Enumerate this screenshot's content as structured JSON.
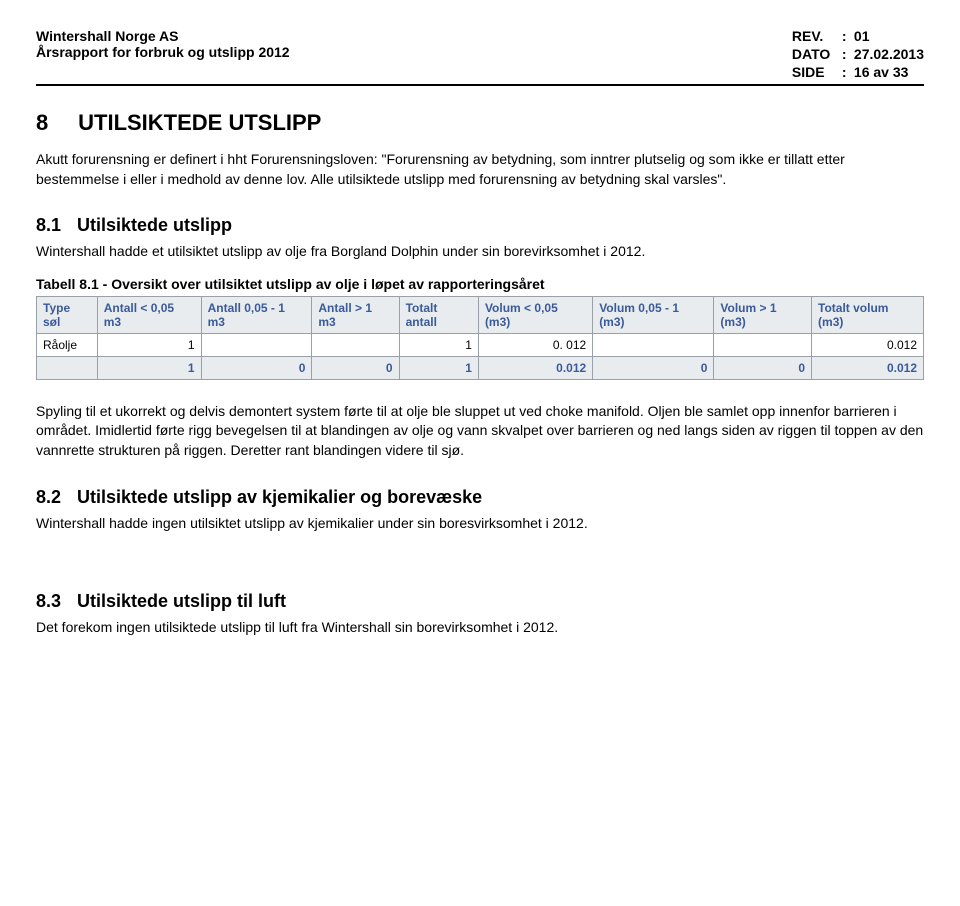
{
  "header": {
    "company": "Wintershall Norge AS",
    "subtitle": "Årsrapport for forbruk og utslipp 2012",
    "meta": {
      "rev_label": "REV.",
      "rev_value": "01",
      "date_label": "DATO",
      "date_value": "27.02.2013",
      "page_label": "SIDE",
      "page_value": "16 av 33"
    }
  },
  "sec8": {
    "number": "8",
    "title": "UTILSIKTEDE UTSLIPP",
    "intro": "Akutt forurensning er definert i hht Forurensningsloven: \"Forurensning av betydning, som inntrer plutselig og som ikke er tillatt etter bestemmelse i eller i medhold av denne lov. Alle utilsiktede utslipp med forurensning av betydning skal varsles\"."
  },
  "sec81": {
    "number": "8.1",
    "title": "Utilsiktede utslipp",
    "body": "Wintershall hadde et utilsiktet utslipp av olje fra Borgland Dolphin under sin borevirksomhet i 2012."
  },
  "table": {
    "caption": "Tabell 8.1 - Oversikt over utilsiktet utslipp av olje i løpet av rapporteringsåret",
    "headers": [
      "Type søl",
      "Antall < 0,05 m3",
      "Antall 0,05 - 1 m3",
      "Antall > 1 m3",
      "Totalt antall",
      "Volum < 0,05 (m3)",
      "Volum 0,05 - 1 (m3)",
      "Volum > 1 (m3)",
      "Totalt volum (m3)"
    ],
    "rows": [
      [
        "Råolje",
        "1",
        "",
        "",
        "1",
        "0. 012",
        "",
        "",
        "0.012"
      ]
    ],
    "totals": [
      "",
      "1",
      "0",
      "0",
      "1",
      "0.012",
      "0",
      "0",
      "0.012"
    ]
  },
  "after_table": "Spyling til et ukorrekt og delvis demontert system førte til at olje ble sluppet ut ved choke manifold. Oljen ble samlet opp innenfor barrieren i området. Imidlertid førte rigg bevegelsen til at blandingen av olje og vann skvalpet over barrieren og ned langs siden av riggen til toppen av den vannrette strukturen på riggen. Deretter rant blandingen videre til sjø.",
  "sec82": {
    "number": "8.2",
    "title": "Utilsiktede utslipp av kjemikalier og borevæske",
    "body": "Wintershall hadde ingen utilsiktet utslipp av kjemikalier under sin boresvirksomhet i 2012."
  },
  "sec83": {
    "number": "8.3",
    "title": "Utilsiktede utslipp til luft",
    "body": "Det forekom ingen utilsiktede utslipp til luft fra Wintershall sin borevirksomhet i 2012."
  }
}
